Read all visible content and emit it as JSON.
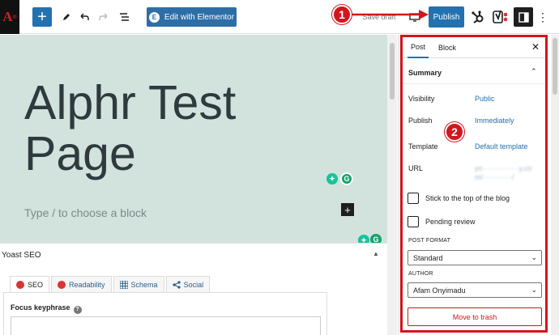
{
  "toolbar": {
    "logo_letter": "A",
    "logo_mark": "®",
    "add_symbol": "+",
    "elementor_badge": "E",
    "elementor_label": "Edit with Elementor",
    "save_draft_label": "Save draft",
    "publish_label": "Publish",
    "more_symbol": "⋮"
  },
  "annotations": {
    "step1": "1",
    "step2": "2",
    "color": "#d2161e"
  },
  "editor": {
    "title": "Alphr Test Page",
    "block_placeholder": "Type / to choose a block",
    "block_add_symbol": "+",
    "grammarly_letter": "G",
    "canvas_color": "#d2e2dc"
  },
  "yoast": {
    "title": "Yoast SEO",
    "collapse_symbol": "▲",
    "tabs": [
      {
        "label": "SEO",
        "icon": "sad-face-icon"
      },
      {
        "label": "Readability",
        "icon": "sad-face-icon"
      },
      {
        "label": "Schema",
        "icon": "grid-icon"
      },
      {
        "label": "Social",
        "icon": "share-icon"
      }
    ],
    "focus_keyphrase_label": "Focus keyphrase",
    "help_symbol": "?"
  },
  "sidebar": {
    "tabs": [
      "Post",
      "Block"
    ],
    "close_symbol": "✕",
    "summary_title": "Summary",
    "summary_chevron": "⌃",
    "rows": {
      "visibility_label": "Visibility",
      "visibility_value": "Public",
      "publish_label": "Publish",
      "publish_value": "Immediately",
      "template_label": "Template",
      "template_value": "Default template",
      "url_label": "URL",
      "url_value_line1": "yo···············y.co",
      "url_value_line2": "m/············/"
    },
    "stick_label": "Stick to the top of the blog",
    "pending_label": "Pending review",
    "post_format_label": "POST FORMAT",
    "post_format_value": "Standard",
    "author_label": "AUTHOR",
    "author_value": "Afam Onyimadu",
    "select_arrow": "⌄",
    "trash_label": "Move to trash"
  },
  "colors": {
    "wp_blue": "#2271b1",
    "danger": "#cc1818"
  }
}
